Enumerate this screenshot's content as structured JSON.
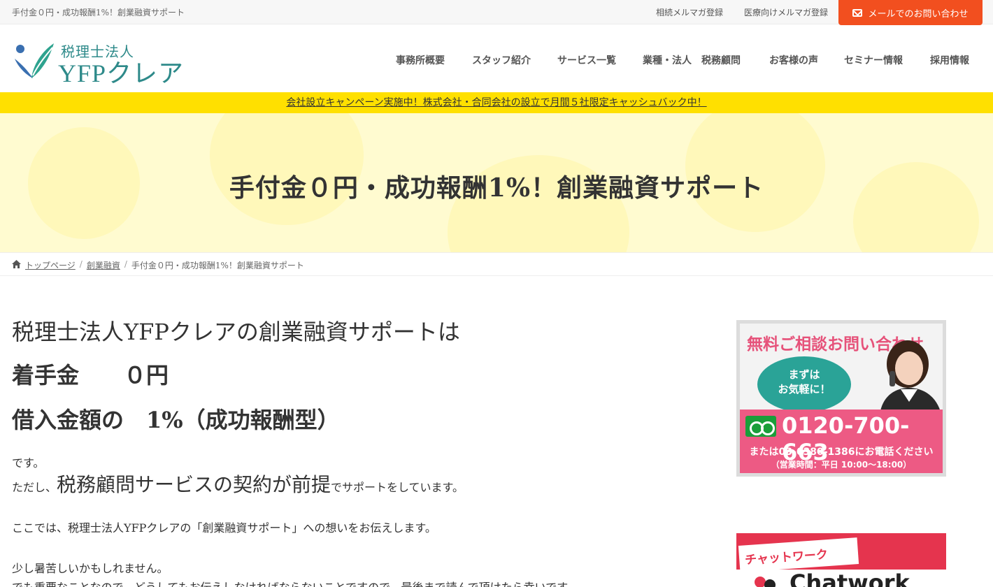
{
  "topbar": {
    "tagline": "手付金０円・成功報酬1%！創業融資サポート",
    "link1": "相続メルマガ登録",
    "link2": "医療向けメルマガ登録",
    "mail_button": "メールでのお問い合わせ",
    "mail_button_color": "#f24f1f"
  },
  "logo": {
    "sub": "税理士法人",
    "main": "YFPクレア",
    "color": "#2e8a8a"
  },
  "nav": [
    {
      "label": "事務所概要"
    },
    {
      "label": "スタッフ紹介"
    },
    {
      "label": "サービス一覧"
    },
    {
      "label": "業種・法人　税務顧問"
    },
    {
      "label": "お客様の声"
    },
    {
      "label": "セミナー情報"
    },
    {
      "label": "採用情報"
    }
  ],
  "campaign": {
    "text": "会社設立キャンペーン実施中！株式会社・合同会社の設立で月間５社限定キャッシュバック中！",
    "color": "#ffe000"
  },
  "hero": {
    "title": "手付金０円・成功報酬1%！創業融資サポート"
  },
  "breadcrumb": {
    "home": "トップページ",
    "category": "創業融資",
    "current": "手付金０円・成功報酬1%！創業融資サポート",
    "separator": "/"
  },
  "content": {
    "lead": "税理士法人YFPクレアの創業融資サポートは",
    "fee1": "着手金　　０円",
    "fee2": "借入金額の　1%（成功報酬型）",
    "p1": "です。",
    "p2_pre": "ただし、",
    "p2_big": "税務顧問サービスの契約が前提",
    "p2_post": "でサポートをしています。",
    "p3": "ここでは、税理士法人YFPクレアの「創業融資サポート」への想いをお伝えします。",
    "p4": "少し暑苦しいかもしれません。",
    "p5": "でも重要なことなので、どうしてもお伝えしなければならないことですので、最後まで読んで頂けたら幸いです。"
  },
  "sidebar": {
    "ad1": {
      "title": "無料ご相談お問い合わせ",
      "bubble_line1": "まずは",
      "bubble_line2": "お気軽に！",
      "phone": "0120-700-663",
      "alt_phone": "または03-6380-1386にお電話ください",
      "hours": "（営業時間：平日 10:00〜18:00）",
      "accent": "#ed5a84",
      "bubble_color": "#2aa397"
    },
    "ad2": {
      "tag": "チャットワーク",
      "brand": "Chatwork",
      "color": "#e5344e"
    }
  }
}
